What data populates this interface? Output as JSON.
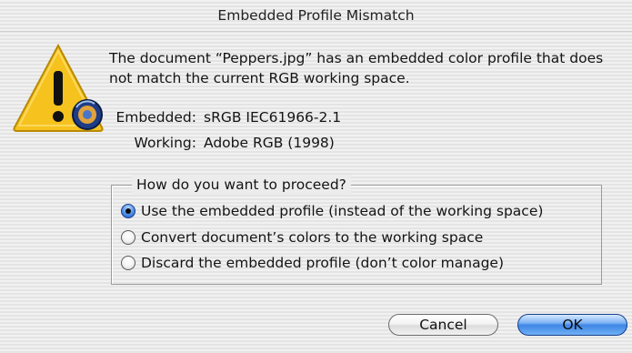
{
  "window": {
    "title": "Embedded Profile Mismatch"
  },
  "icon": {
    "name": "caution-colorsync-icon",
    "warning_color": "#f6c21d",
    "glyph": "!"
  },
  "message": {
    "text": "The document “Peppers.jpg” has an embedded color profile that does not match the current RGB working space."
  },
  "profiles": {
    "embedded_label": "Embedded:",
    "embedded_value": "sRGB IEC61966-2.1",
    "working_label": "Working:",
    "working_value": "Adobe RGB (1998)"
  },
  "options": {
    "group_title": "How do you want to proceed?",
    "items": [
      {
        "label": "Use the embedded profile (instead of the working space)",
        "checked": true
      },
      {
        "label": "Convert document’s colors to the working space",
        "checked": false
      },
      {
        "label": "Discard the embedded profile (don’t color manage)",
        "checked": false
      }
    ]
  },
  "buttons": {
    "cancel_label": "Cancel",
    "ok_label": "OK",
    "default_color": "#3e86e6"
  }
}
